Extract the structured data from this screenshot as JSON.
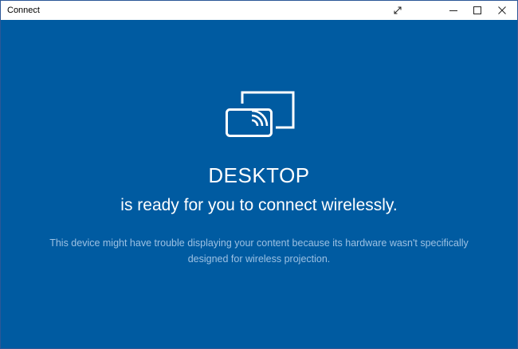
{
  "window": {
    "title": "Connect",
    "buttons": {
      "expand_icon": "expand-diagonal-icon",
      "minimize_icon": "minimize-icon",
      "maximize_icon": "maximize-icon",
      "close_icon": "close-icon"
    }
  },
  "main": {
    "icon": "wireless-projection-icon",
    "device_name": "DESKTOP",
    "ready_message": "is ready for you to connect wirelessly.",
    "warning_message": "This device might have trouble displaying your content because its hardware wasn't specifically designed for wireless projection."
  },
  "colors": {
    "background": "#005ba1",
    "primary_text": "#ffffff",
    "secondary_text": "#9cc1e3"
  }
}
